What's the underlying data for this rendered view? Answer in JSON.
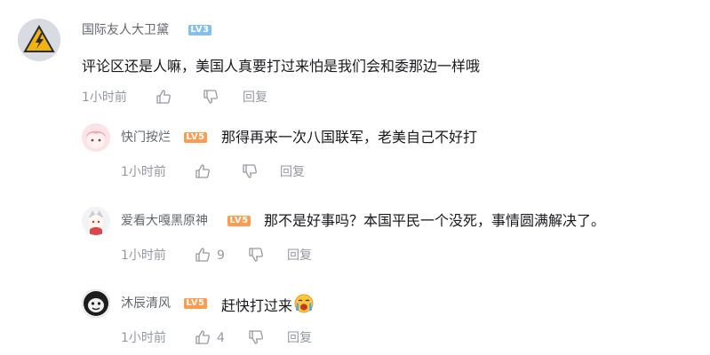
{
  "comments": [
    {
      "user": "国际友人大卫黛",
      "level": "LV3",
      "text": "评论区还是人嘛，美国人真要打过来怕是我们会和委那边一样哦",
      "time": "1小时前",
      "likes": "",
      "reply_label": "回复"
    },
    {
      "user": "快门按烂",
      "level": "LV5",
      "text": "那得再来一次八国联军，老美自己不好打",
      "time": "1小时前",
      "likes": "",
      "reply_label": "回复"
    },
    {
      "user": "爱看大嘎黑原神",
      "level": "LV5",
      "text": "那不是好事吗？本国平民一个没死，事情圆满解决了。",
      "time": "1小时前",
      "likes": "9",
      "reply_label": "回复"
    },
    {
      "user": "沐辰清风",
      "level": "LV5",
      "text": "赶快打过来",
      "time": "1小时前",
      "likes": "4",
      "reply_label": "回复"
    }
  ],
  "colors": {
    "lv3": "#84c0e7",
    "lv5": "#ff9a4e",
    "meta_text": "#9499a0",
    "username": "#61666d"
  },
  "icons": {
    "like": "thumb-up-icon",
    "dislike": "thumb-down-icon",
    "emoji": "crying-face-emoji"
  }
}
